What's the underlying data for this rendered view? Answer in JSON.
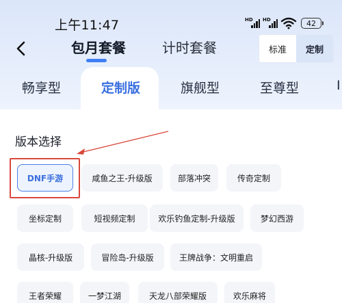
{
  "status_bar": {
    "time": "上午11:47",
    "signal_label_1": "HD",
    "signal_label_2": "HD",
    "battery_level": "42"
  },
  "header": {
    "tabs": [
      {
        "label": "包月套餐",
        "active": true
      },
      {
        "label": "计时套餐",
        "active": false
      }
    ],
    "mode_toggle": [
      {
        "label": "标准",
        "active": false
      },
      {
        "label": "定制",
        "active": true
      }
    ]
  },
  "edition_tabs": [
    {
      "label": "畅享型",
      "active": false
    },
    {
      "label": "定制版",
      "active": true
    },
    {
      "label": "旗舰型",
      "active": false
    },
    {
      "label": "至尊型",
      "active": false
    },
    {
      "label": "I",
      "active": false
    }
  ],
  "section": {
    "title": "版本选择"
  },
  "versions": [
    {
      "label": "DNF手游",
      "selected": true
    },
    {
      "label": "咸鱼之王-升级版",
      "selected": false
    },
    {
      "label": "部落冲突",
      "selected": false
    },
    {
      "label": "传奇定制",
      "selected": false
    },
    {
      "label": "坐标定制",
      "selected": false
    },
    {
      "label": "短视频定制",
      "selected": false
    },
    {
      "label": "欢乐钓鱼定制-升级版",
      "selected": false
    },
    {
      "label": "梦幻西游",
      "selected": false
    },
    {
      "label": "晶核-升级版",
      "selected": false
    },
    {
      "label": "冒险岛-升级版",
      "selected": false
    },
    {
      "label": "王牌战争：文明重启",
      "selected": false
    },
    {
      "label": "王者荣耀",
      "selected": false
    },
    {
      "label": "一梦江湖",
      "selected": false
    },
    {
      "label": "天龙八部荣耀版",
      "selected": false
    },
    {
      "label": "欢乐麻将",
      "selected": false
    }
  ],
  "colors": {
    "accent": "#3f7ef4",
    "annotation": "#d9473b"
  }
}
